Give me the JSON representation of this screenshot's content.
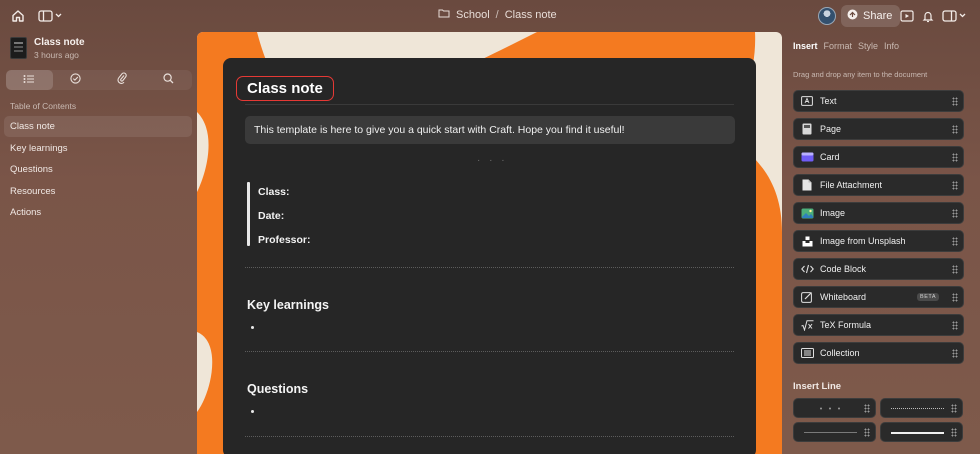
{
  "topbar": {
    "breadcrumb": [
      "School",
      "Class note"
    ],
    "share_label": "Share"
  },
  "sidebar": {
    "doc_title": "Class note",
    "doc_time": "3 hours ago",
    "toc_label": "Table of Contents",
    "toc": [
      "Class note",
      "Key learnings",
      "Questions",
      "Resources",
      "Actions"
    ]
  },
  "doc": {
    "title": "Class note",
    "callout": "This template is here to give you a quick start with Craft. Hope you find it useful!",
    "separator": "· · ·",
    "fields": [
      "Class:",
      "Date:",
      "Professor:"
    ],
    "sections": [
      "Key learnings",
      "Questions"
    ]
  },
  "panel": {
    "tabs": [
      "Insert",
      "Format",
      "Style",
      "Info"
    ],
    "hint": "Drag and drop any item to the document",
    "blocks": [
      {
        "label": "Text",
        "icon": "text-icon"
      },
      {
        "label": "Page",
        "icon": "page-icon"
      },
      {
        "label": "Card",
        "icon": "card-icon"
      },
      {
        "label": "File Attachment",
        "icon": "file-icon"
      },
      {
        "label": "Image",
        "icon": "image-icon"
      },
      {
        "label": "Image from Unsplash",
        "icon": "unsplash-icon"
      },
      {
        "label": "Code Block",
        "icon": "code-icon"
      },
      {
        "label": "Whiteboard",
        "icon": "whiteboard-icon",
        "badge": "BETA"
      },
      {
        "label": "TeX Formula",
        "icon": "tex-icon"
      },
      {
        "label": "Collection",
        "icon": "collection-icon"
      }
    ],
    "insert_line_title": "Insert Line"
  },
  "colors": {
    "accent_orange": "#f47a20",
    "title_outline": "#e53935",
    "card_bg": "#262626"
  }
}
